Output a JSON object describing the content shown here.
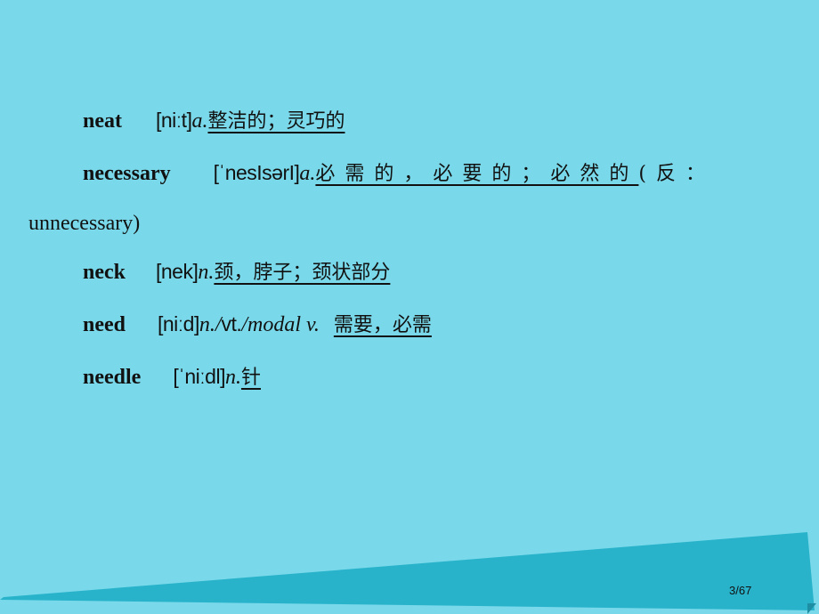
{
  "slide": {
    "page_indicator": "3/67",
    "colors": {
      "background": "#79d9ea",
      "ribbon": "#29b3cb",
      "ribbon_fold": "#1d8ea3",
      "text": "#111111"
    },
    "entries": [
      {
        "word": "neat",
        "phonetic": "[niːt]",
        "pos": "a.",
        "definition": "整洁的；灵巧的"
      },
      {
        "word": "necessary",
        "phonetic": "[ˈnesIsərI]",
        "pos": "a.",
        "definition": "必需的，必要的；必然的",
        "note_open": "(反：",
        "note_close": "unnecessary)"
      },
      {
        "word": "neck",
        "phonetic": "[nek]",
        "pos": "n.",
        "definition": "颈，脖子；颈状部分"
      },
      {
        "word": "need",
        "phonetic": "[niːd]",
        "pos": "n./vt./modal v.",
        "pos_parts": [
          "n./",
          "vt.",
          "/modal v."
        ],
        "definition": "需要，必需"
      },
      {
        "word": "needle",
        "phonetic": "[ˈniːdl]",
        "pos": "n.",
        "definition": "针"
      }
    ]
  }
}
